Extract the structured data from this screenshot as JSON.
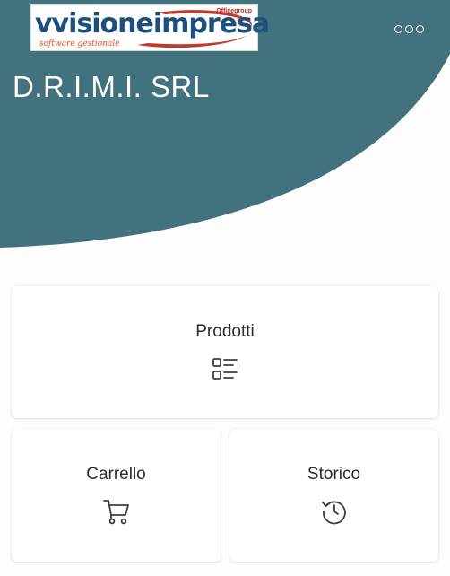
{
  "header": {
    "logo": {
      "brand_text": "vvisioneimpresa",
      "tagline": "software gestionale",
      "badge": "Officegroup"
    },
    "company_name": "D.R.I.M.I. SRL",
    "menu_icon": "more-horizontal-icon"
  },
  "cards": [
    {
      "label": "Prodotti",
      "icon": "list-icon"
    },
    {
      "label": "Carrello",
      "icon": "cart-icon"
    },
    {
      "label": "Storico",
      "icon": "history-icon"
    }
  ],
  "colors": {
    "hero": "#43727f",
    "text_on_hero": "#ffffff",
    "card_text": "#2a2a33",
    "icon": "#3a3f4a",
    "background": "#fdfdfd"
  }
}
